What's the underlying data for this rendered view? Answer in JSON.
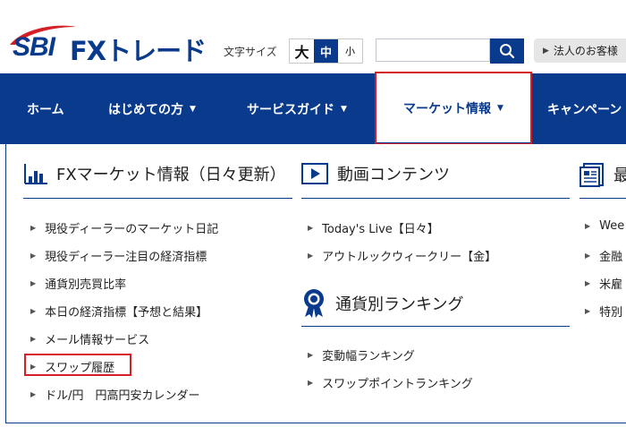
{
  "brand": {
    "sbi": "SBI",
    "fx": "FXトレード"
  },
  "font_size": {
    "label": "文字サイズ",
    "large": "大",
    "medium": "中",
    "small": "小"
  },
  "search": {
    "placeholder": ""
  },
  "corporate_button": "法人のお客様",
  "nav": {
    "home": "ホーム",
    "beginners": "はじめての方",
    "service_guide": "サービスガイド",
    "market_info": "マーケット情報",
    "campaign": "キャンペーン"
  },
  "sections": {
    "fx_market": {
      "title": "FXマーケット情報（日々更新）",
      "items": [
        "現役ディーラーのマーケット日記",
        "現役ディーラー注目の経済指標",
        "通貨別売買比率",
        "本日の経済指標【予想と結果】",
        "メール情報サービス",
        "スワップ履歴",
        "ドル/円　円高円安カレンダー"
      ]
    },
    "video": {
      "title": "動画コンテンツ",
      "items": [
        "Today's Live【日々】",
        "アウトルックウィークリー【金】"
      ]
    },
    "ranking": {
      "title": "通貨別ランキング",
      "items": [
        "変動幅ランキング",
        "スワップポイントランキング"
      ]
    },
    "latest": {
      "title": "最",
      "items": [
        "Wee",
        "金融",
        "米雇",
        "特別"
      ]
    }
  },
  "colors": {
    "brand_blue": "#0a3a8c",
    "highlight_red": "#d41f26"
  },
  "icons": [
    "search-icon",
    "chart-icon",
    "play-icon",
    "medal-icon",
    "report-icon"
  ]
}
